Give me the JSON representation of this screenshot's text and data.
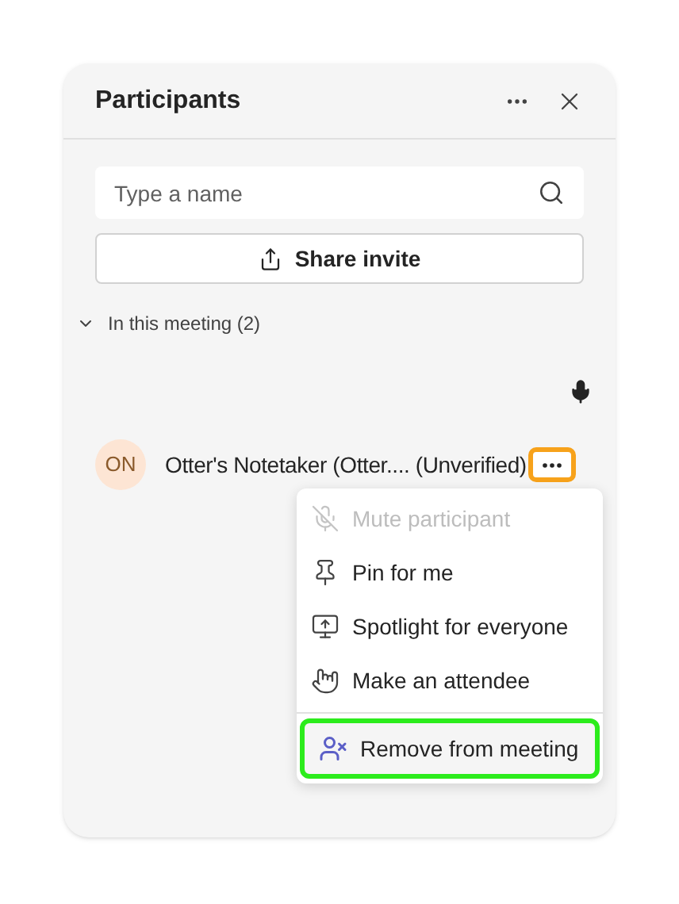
{
  "panel": {
    "title": "Participants"
  },
  "search": {
    "placeholder": "Type a name"
  },
  "share_button": {
    "label": "Share invite"
  },
  "section": {
    "label": "In this meeting (2)",
    "expanded": true
  },
  "participants": [
    {
      "initials": "ON",
      "name": "Otter's Notetaker (Otter.... (Unverified)",
      "more_highlighted": true
    }
  ],
  "menu": {
    "groups": [
      [
        {
          "kind": "mic-off",
          "label": "Mute participant",
          "disabled": true,
          "highlighted": false
        },
        {
          "kind": "pin",
          "label": "Pin for me",
          "disabled": false,
          "highlighted": false
        },
        {
          "kind": "spotlight",
          "label": "Spotlight for everyone",
          "disabled": false,
          "highlighted": false
        },
        {
          "kind": "attendee",
          "label": "Make an attendee",
          "disabled": false,
          "highlighted": false
        }
      ],
      [
        {
          "kind": "remove",
          "label": "Remove from meeting",
          "disabled": false,
          "highlighted": true
        }
      ]
    ]
  }
}
